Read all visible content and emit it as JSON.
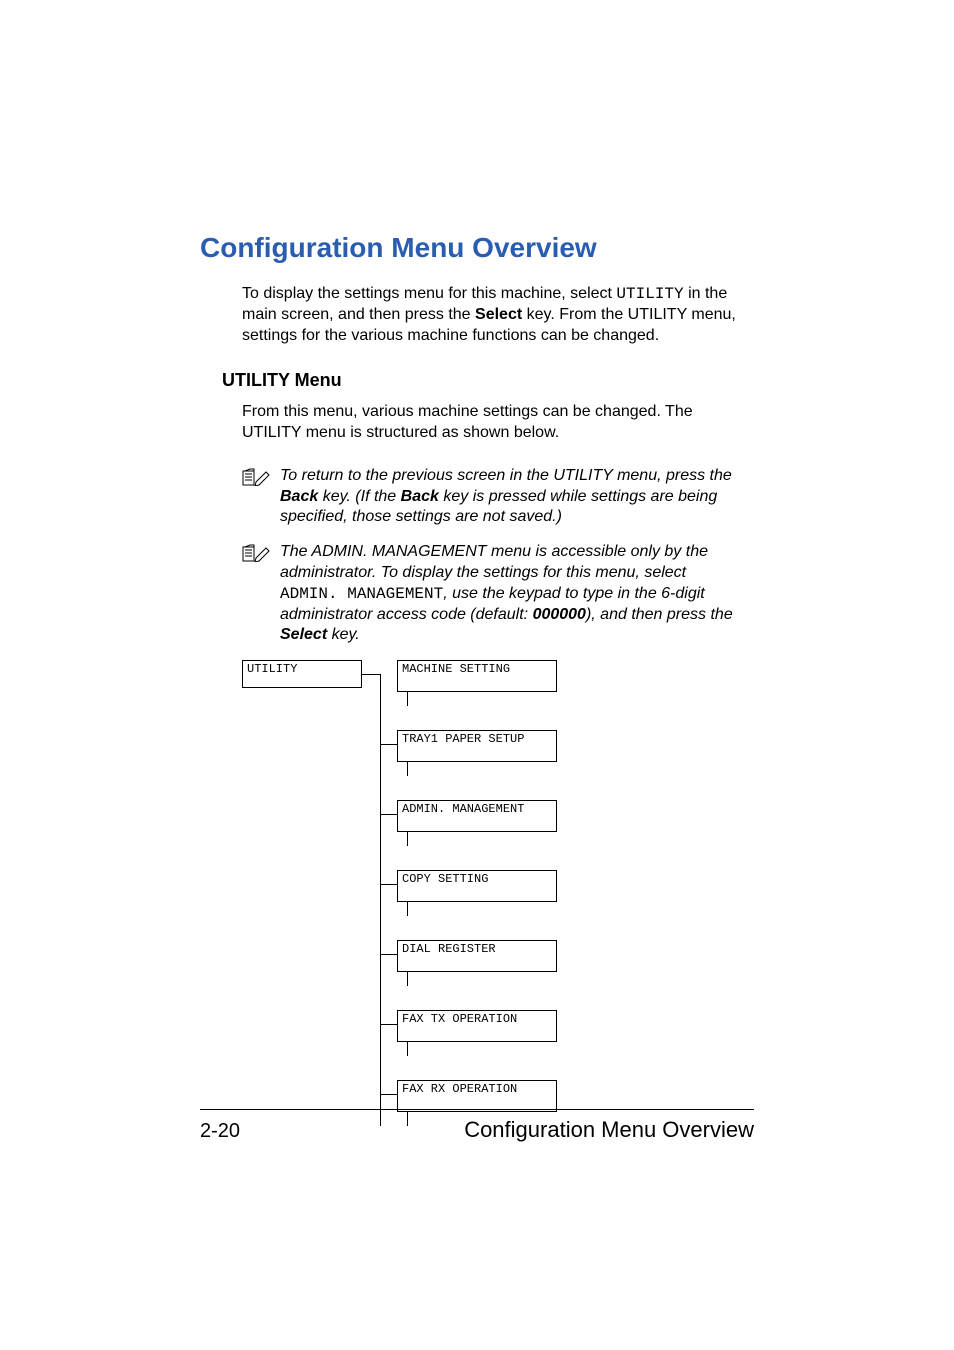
{
  "title": "Configuration Menu Overview",
  "intro": {
    "pre": "To display the settings menu for this machine, select ",
    "code": "UTILITY",
    "mid": " in the main screen, and then press the ",
    "bold": "Select",
    "post": " key. From the UTILITY menu, settings for the various machine functions can be changed."
  },
  "section": "UTILITY Menu",
  "section_intro": "From this menu, various machine settings can be changed. The UTILITY menu is structured as shown below.",
  "note1": {
    "a": "To return to the previous screen in the UTILITY menu, press the ",
    "b1": "Back",
    "c": " key. (If the ",
    "b2": "Back",
    "d": " key is pressed while settings are being specified, those settings are not saved.)"
  },
  "note2": {
    "a": "The ADMIN. MANAGEMENT menu is accessible only by the administrator. To display the settings for this menu, select ",
    "code": "ADMIN. MANAGEMENT",
    "b": ", use the keypad to type in the 6-digit administrator access code (default: ",
    "bold1": "000000",
    "c": "), and then press the ",
    "bold2": "Select",
    "d": " key."
  },
  "tree": {
    "root": "UTILITY",
    "children": [
      "MACHINE SETTING",
      "TRAY1 PAPER SETUP",
      "ADMIN. MANAGEMENT",
      "COPY SETTING",
      "DIAL REGISTER",
      "FAX TX OPERATION",
      "FAX RX OPERATION"
    ]
  },
  "footer": {
    "left": "2-20",
    "right": "Configuration Menu Overview"
  }
}
